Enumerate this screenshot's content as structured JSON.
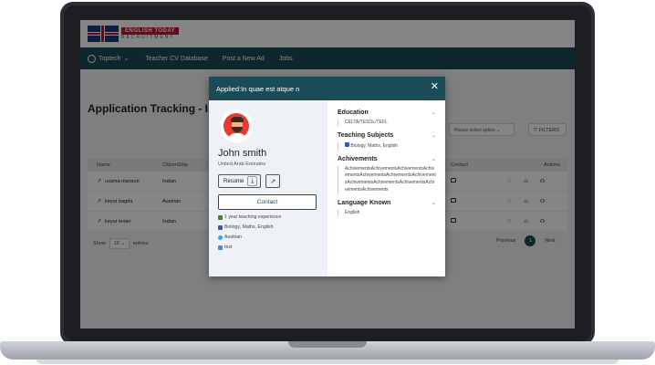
{
  "logo": {
    "line1": "ENGLISH TODAY",
    "line2": "RECRUITMENT"
  },
  "nav": {
    "user": "Toptech",
    "items": [
      "Teacher CV Database",
      "Post a New Ad",
      "Jobs"
    ]
  },
  "page": {
    "title": "Application Tracking - In",
    "filter_placeholder": "Please select option",
    "filters_label": "FILTERS"
  },
  "table": {
    "headers": {
      "name": "Name",
      "citizenship": "CitizenShip",
      "contact": "Contact",
      "actions": "Actions"
    },
    "rows": [
      {
        "name": "usama mansuri",
        "citizenship": "Indian"
      },
      {
        "name": "keyur bagda",
        "citizenship": "Austrian"
      },
      {
        "name": "keyur tester",
        "citizenship": "Indian"
      }
    ],
    "show_label": "Show",
    "show_value": "10",
    "entries_label": "entries",
    "pager": {
      "previous": "Previous",
      "current": "1",
      "next": "Next"
    }
  },
  "modal": {
    "title": "Applied:In quae est atque n",
    "close_glyph": "✕",
    "candidate": {
      "name": "John smith",
      "country": "United Arab Emirates",
      "resume_label": "Resume",
      "contact_label": "Contact",
      "experience": "1 year teaching experience",
      "subjects": "Biology, Maths, English",
      "nationality": "Austrian",
      "note": "test"
    },
    "sections": {
      "education": {
        "title": "Education",
        "body": "CELTA/TESOL/TEFL"
      },
      "subjects": {
        "title": "Teaching Subjects",
        "body": "Biology, Maths, English"
      },
      "achievements": {
        "title": "Achivements",
        "body": "AchivementsAchivementsAchivementsAchivementsAchivementsAchivementsAchivementsAchivementsAchivementsAchivementsAchivementsAchivements"
      },
      "languages": {
        "title": "Language Known",
        "body": "English"
      }
    }
  },
  "colors": {
    "brand_teal": "#1b4b57",
    "logo_red": "#c8102e",
    "avatar_bg": "#e63b2e"
  },
  "icons": [
    "user-circle-icon",
    "chevron-down-icon",
    "filter-icon",
    "external-link-icon",
    "heart-icon",
    "chat-icon",
    "headset-icon",
    "download-icon",
    "close-icon",
    "book-icon",
    "globe-icon",
    "person-icon"
  ]
}
